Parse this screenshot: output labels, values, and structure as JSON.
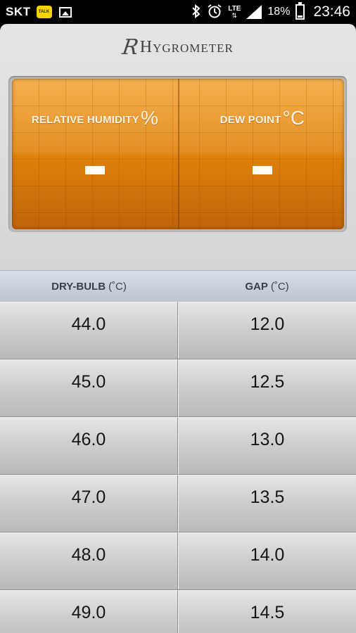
{
  "status_bar": {
    "carrier": "SKT",
    "kakao_label": "TALK",
    "network": "LTE",
    "network_arrows": "⇅",
    "battery_percent": "18%",
    "battery_level": 0.18,
    "time": "23:46",
    "icons": [
      "kakaotalk-icon",
      "gallery-icon",
      "bluetooth-icon",
      "alarm-icon",
      "lte-icon",
      "signal-icon",
      "battery-icon"
    ]
  },
  "header": {
    "logo_mark": "R",
    "title": "Hygrometer"
  },
  "display": {
    "humidity": {
      "label": "RELATIVE HUMIDITY",
      "unit": "%",
      "value": "—"
    },
    "dew_point": {
      "label": "DEW POINT",
      "unit": "°C",
      "value": "—"
    },
    "colors": {
      "panel_top": "#f29a1e",
      "panel_bottom": "#c9690a"
    }
  },
  "table": {
    "columns": [
      {
        "label": "DRY-BULB",
        "unit": "(˚C)"
      },
      {
        "label": "GAP",
        "unit": "(˚C)"
      }
    ],
    "rows": [
      [
        "44.0",
        "12.0"
      ],
      [
        "45.0",
        "12.5"
      ],
      [
        "46.0",
        "13.0"
      ],
      [
        "47.0",
        "13.5"
      ],
      [
        "48.0",
        "14.0"
      ],
      [
        "49.0",
        "14.5"
      ]
    ]
  }
}
